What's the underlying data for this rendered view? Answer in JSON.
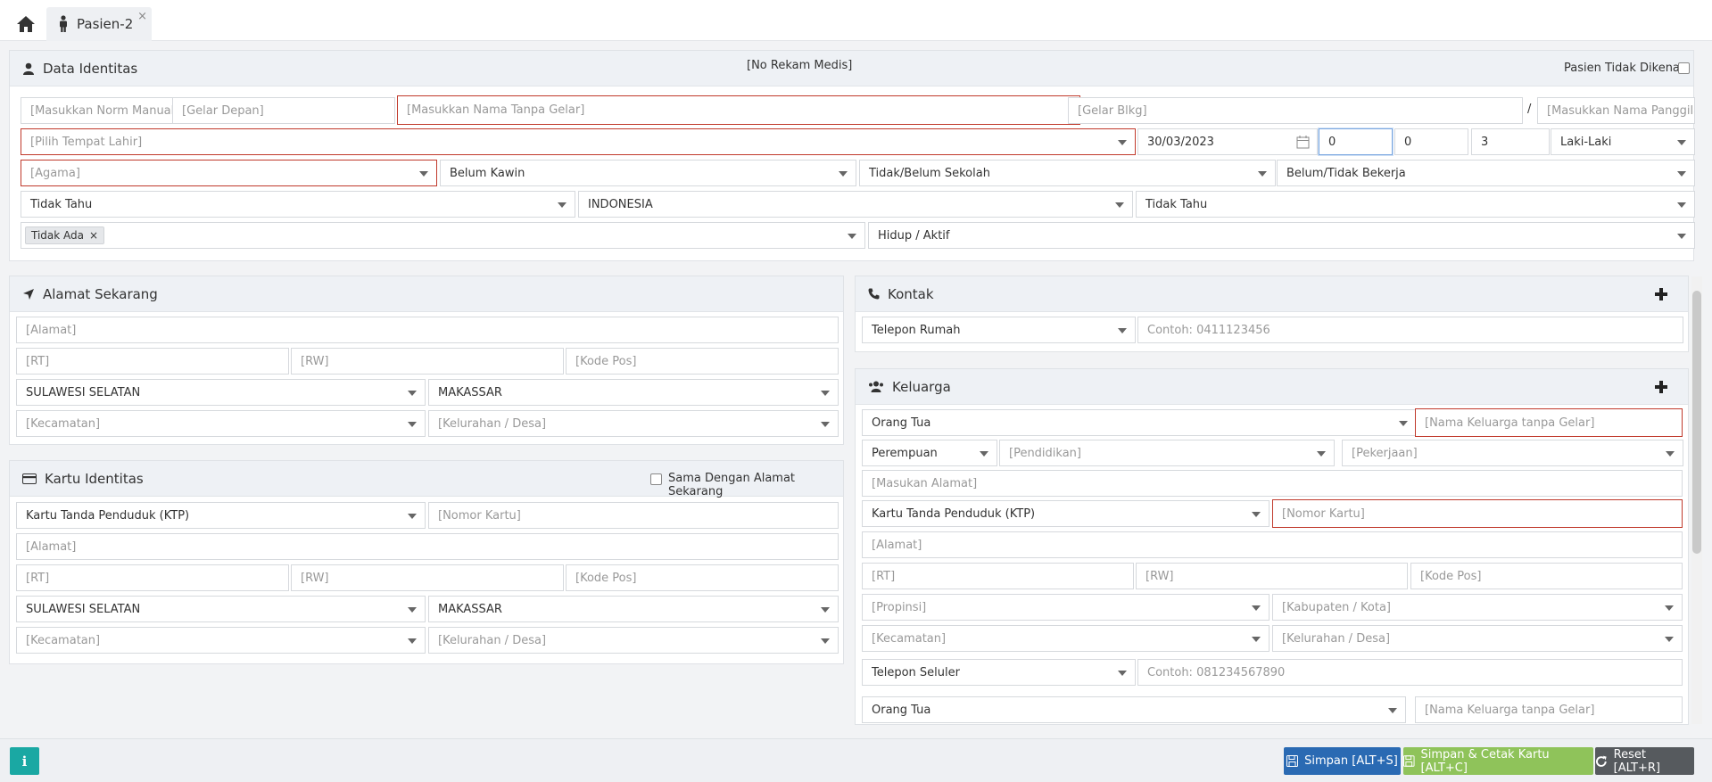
{
  "tabs": {
    "home_icon": "home-icon",
    "active": "Pasien-2",
    "close": "×"
  },
  "identitas": {
    "title": "Data Identitas",
    "no_rm": "[No Rekam Medis]",
    "unknown_label": "Pasien Tidak Dikenal",
    "norm": "[Masukkan Norm Manual]",
    "gelar_depan": "[Gelar Depan]",
    "nama": "[Masukkan Nama Tanpa Gelar]",
    "gelar_blkg": "[Gelar Blkg]",
    "slash": "/",
    "panggilan": "[Masukkan Nama Panggilan]",
    "tempat_lahir": "[Pilih Tempat Lahir]",
    "tgl_lahir": "30/03/2023",
    "umur_th": "0",
    "umur_bl": "0",
    "umur_hr": "3",
    "jk": "Laki-Laki",
    "agama": "[Agama]",
    "kawin": "Belum Kawin",
    "pendidikan": "Tidak/Belum Sekolah",
    "pekerjaan": "Belum/Tidak Bekerja",
    "goldar": "Tidak Tahu",
    "negara": "INDONESIA",
    "suku": "Tidak Tahu",
    "tag": "Tidak Ada",
    "tag_remove": "×",
    "status": "Hidup / Aktif"
  },
  "alamat": {
    "title": "Alamat Sekarang",
    "alamat": "[Alamat]",
    "rt": "[RT]",
    "rw": "[RW]",
    "kodepos": "[Kode Pos]",
    "prov": "SULAWESI SELATAN",
    "kota": "MAKASSAR",
    "kec": "[Kecamatan]",
    "kel": "[Kelurahan / Desa]"
  },
  "kartu": {
    "title": "Kartu Identitas",
    "same_label": "Sama Dengan Alamat Sekarang",
    "jenis": "Kartu Tanda Penduduk (KTP)",
    "nomor": "[Nomor Kartu]",
    "alamat": "[Alamat]",
    "rt": "[RT]",
    "rw": "[RW]",
    "kodepos": "[Kode Pos]",
    "prov": "SULAWESI SELATAN",
    "kota": "MAKASSAR",
    "kec": "[Kecamatan]",
    "kel": "[Kelurahan / Desa]"
  },
  "kontak": {
    "title": "Kontak",
    "jenis": "Telepon Rumah",
    "nomor": "Contoh: 0411123456"
  },
  "keluarga": {
    "title": "Keluarga",
    "hubungan": "Orang Tua",
    "nama": "[Nama Keluarga tanpa Gelar]",
    "jk": "Perempuan",
    "pendidikan": "[Pendidikan]",
    "pekerjaan": "[Pekerjaan]",
    "alamat_masuk": "[Masukan Alamat]",
    "kartu": "Kartu Tanda Penduduk (KTP)",
    "nomor_kartu": "[Nomor Kartu]",
    "alamat": "[Alamat]",
    "rt": "[RT]",
    "rw": "[RW]",
    "kodepos": "[Kode Pos]",
    "prov": "[Propinsi]",
    "kab": "[Kabupaten / Kota]",
    "kec": "[Kecamatan]",
    "kel": "[Kelurahan / Desa]",
    "telp_jenis": "Telepon Seluler",
    "telp": "Contoh: 081234567890",
    "hubungan2": "Orang Tua",
    "nama2": "[Nama Keluarga tanpa Gelar]"
  },
  "footer": {
    "info": "i",
    "save": "Simpan [ALT+S]",
    "save_print": "Simpan & Cetak Kartu [ALT+C]",
    "reset": "Reset [ALT+R]"
  },
  "colors": {
    "save": "#2a6ab3",
    "save_print": "#8fc35a",
    "reset": "#565a5e",
    "info": "#1aa8a3",
    "required": "#c0392b"
  }
}
